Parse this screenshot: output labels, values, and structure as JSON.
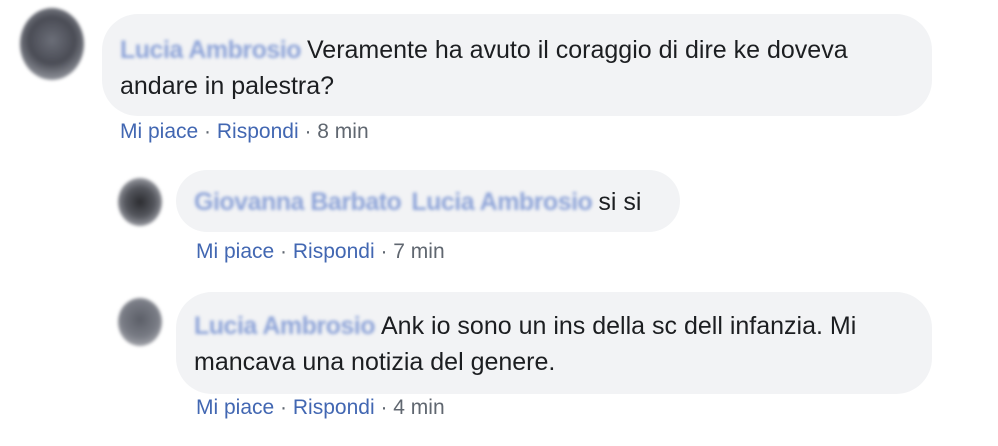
{
  "comments": [
    {
      "author": "Lucia Ambrosio",
      "text": "Veramente ha avuto il coraggio di dire ke doveva andare in palestra?",
      "like_label": "Mi piace",
      "reply_label": "Rispondi",
      "time": "8 min"
    },
    {
      "author": "Giovanna Barbato",
      "mention": "Lucia Ambrosio",
      "text": "si si",
      "like_label": "Mi piace",
      "reply_label": "Rispondi",
      "time": "7 min"
    },
    {
      "author": "Lucia Ambrosio",
      "text": "Ank io sono un ins della sc dell infanzia. Mi mancava una notizia del genere.",
      "like_label": "Mi piace",
      "reply_label": "Rispondi",
      "time": "4 min"
    }
  ],
  "separator": "·",
  "colors": {
    "link": "#4267b2",
    "bubble": "#f2f3f5",
    "meta": "#606770"
  }
}
